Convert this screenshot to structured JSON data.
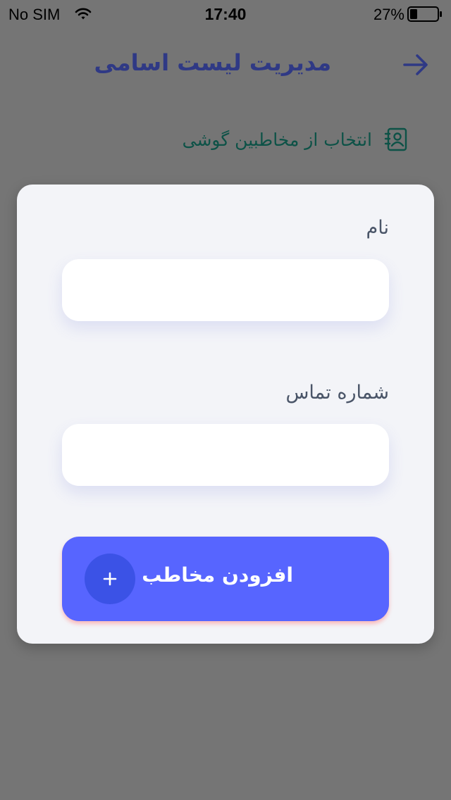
{
  "status_bar": {
    "carrier": "No SIM",
    "time": "17:40",
    "battery_percent": "27%",
    "battery_level": 0.27,
    "wifi_icon": "wifi-icon",
    "battery_icon": "battery-icon"
  },
  "header": {
    "title": "مدیریت لیست اسامی",
    "back_icon": "arrow-right-icon"
  },
  "pick_contacts": {
    "label": "انتخاب از مخاطبین گوشی",
    "icon": "contact-book-icon"
  },
  "form": {
    "name_label": "نام",
    "name_value": "",
    "phone_label": "شماره تماس",
    "phone_value": "",
    "add_button_label": "افزودن مخاطب",
    "add_icon": "plus-icon"
  },
  "colors": {
    "overlay": "#757575",
    "title": "#2f3985",
    "pick_label": "#0d5247",
    "card": "#f3f4f8",
    "button": "#5765ff",
    "button_icon_bg": "#3b52e6"
  }
}
